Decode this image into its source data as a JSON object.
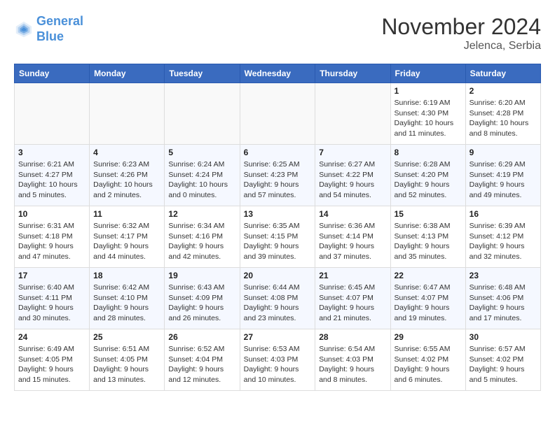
{
  "header": {
    "logo_line1": "General",
    "logo_line2": "Blue",
    "month_title": "November 2024",
    "location": "Jelenca, Serbia"
  },
  "weekdays": [
    "Sunday",
    "Monday",
    "Tuesday",
    "Wednesday",
    "Thursday",
    "Friday",
    "Saturday"
  ],
  "weeks": [
    [
      {
        "day": "",
        "info": ""
      },
      {
        "day": "",
        "info": ""
      },
      {
        "day": "",
        "info": ""
      },
      {
        "day": "",
        "info": ""
      },
      {
        "day": "",
        "info": ""
      },
      {
        "day": "1",
        "info": "Sunrise: 6:19 AM\nSunset: 4:30 PM\nDaylight: 10 hours\nand 11 minutes."
      },
      {
        "day": "2",
        "info": "Sunrise: 6:20 AM\nSunset: 4:28 PM\nDaylight: 10 hours\nand 8 minutes."
      }
    ],
    [
      {
        "day": "3",
        "info": "Sunrise: 6:21 AM\nSunset: 4:27 PM\nDaylight: 10 hours\nand 5 minutes."
      },
      {
        "day": "4",
        "info": "Sunrise: 6:23 AM\nSunset: 4:26 PM\nDaylight: 10 hours\nand 2 minutes."
      },
      {
        "day": "5",
        "info": "Sunrise: 6:24 AM\nSunset: 4:24 PM\nDaylight: 10 hours\nand 0 minutes."
      },
      {
        "day": "6",
        "info": "Sunrise: 6:25 AM\nSunset: 4:23 PM\nDaylight: 9 hours\nand 57 minutes."
      },
      {
        "day": "7",
        "info": "Sunrise: 6:27 AM\nSunset: 4:22 PM\nDaylight: 9 hours\nand 54 minutes."
      },
      {
        "day": "8",
        "info": "Sunrise: 6:28 AM\nSunset: 4:20 PM\nDaylight: 9 hours\nand 52 minutes."
      },
      {
        "day": "9",
        "info": "Sunrise: 6:29 AM\nSunset: 4:19 PM\nDaylight: 9 hours\nand 49 minutes."
      }
    ],
    [
      {
        "day": "10",
        "info": "Sunrise: 6:31 AM\nSunset: 4:18 PM\nDaylight: 9 hours\nand 47 minutes."
      },
      {
        "day": "11",
        "info": "Sunrise: 6:32 AM\nSunset: 4:17 PM\nDaylight: 9 hours\nand 44 minutes."
      },
      {
        "day": "12",
        "info": "Sunrise: 6:34 AM\nSunset: 4:16 PM\nDaylight: 9 hours\nand 42 minutes."
      },
      {
        "day": "13",
        "info": "Sunrise: 6:35 AM\nSunset: 4:15 PM\nDaylight: 9 hours\nand 39 minutes."
      },
      {
        "day": "14",
        "info": "Sunrise: 6:36 AM\nSunset: 4:14 PM\nDaylight: 9 hours\nand 37 minutes."
      },
      {
        "day": "15",
        "info": "Sunrise: 6:38 AM\nSunset: 4:13 PM\nDaylight: 9 hours\nand 35 minutes."
      },
      {
        "day": "16",
        "info": "Sunrise: 6:39 AM\nSunset: 4:12 PM\nDaylight: 9 hours\nand 32 minutes."
      }
    ],
    [
      {
        "day": "17",
        "info": "Sunrise: 6:40 AM\nSunset: 4:11 PM\nDaylight: 9 hours\nand 30 minutes."
      },
      {
        "day": "18",
        "info": "Sunrise: 6:42 AM\nSunset: 4:10 PM\nDaylight: 9 hours\nand 28 minutes."
      },
      {
        "day": "19",
        "info": "Sunrise: 6:43 AM\nSunset: 4:09 PM\nDaylight: 9 hours\nand 26 minutes."
      },
      {
        "day": "20",
        "info": "Sunrise: 6:44 AM\nSunset: 4:08 PM\nDaylight: 9 hours\nand 23 minutes."
      },
      {
        "day": "21",
        "info": "Sunrise: 6:45 AM\nSunset: 4:07 PM\nDaylight: 9 hours\nand 21 minutes."
      },
      {
        "day": "22",
        "info": "Sunrise: 6:47 AM\nSunset: 4:07 PM\nDaylight: 9 hours\nand 19 minutes."
      },
      {
        "day": "23",
        "info": "Sunrise: 6:48 AM\nSunset: 4:06 PM\nDaylight: 9 hours\nand 17 minutes."
      }
    ],
    [
      {
        "day": "24",
        "info": "Sunrise: 6:49 AM\nSunset: 4:05 PM\nDaylight: 9 hours\nand 15 minutes."
      },
      {
        "day": "25",
        "info": "Sunrise: 6:51 AM\nSunset: 4:05 PM\nDaylight: 9 hours\nand 13 minutes."
      },
      {
        "day": "26",
        "info": "Sunrise: 6:52 AM\nSunset: 4:04 PM\nDaylight: 9 hours\nand 12 minutes."
      },
      {
        "day": "27",
        "info": "Sunrise: 6:53 AM\nSunset: 4:03 PM\nDaylight: 9 hours\nand 10 minutes."
      },
      {
        "day": "28",
        "info": "Sunrise: 6:54 AM\nSunset: 4:03 PM\nDaylight: 9 hours\nand 8 minutes."
      },
      {
        "day": "29",
        "info": "Sunrise: 6:55 AM\nSunset: 4:02 PM\nDaylight: 9 hours\nand 6 minutes."
      },
      {
        "day": "30",
        "info": "Sunrise: 6:57 AM\nSunset: 4:02 PM\nDaylight: 9 hours\nand 5 minutes."
      }
    ]
  ]
}
